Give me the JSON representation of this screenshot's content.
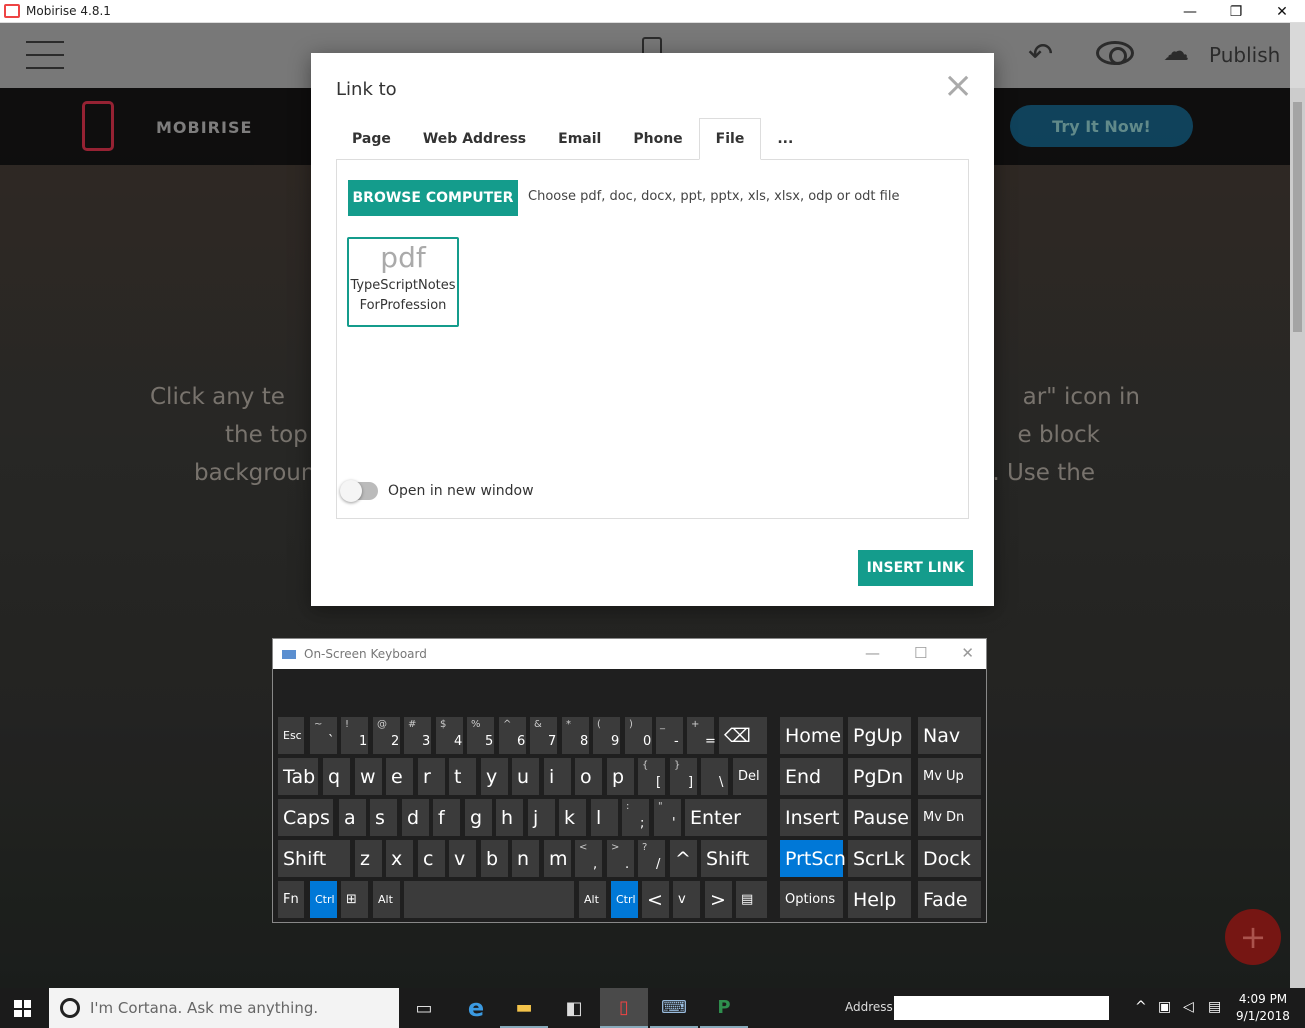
{
  "window": {
    "title": "Mobirise 4.8.1",
    "min": "—",
    "max": "❐",
    "close": "✕"
  },
  "toolbar": {
    "publish_label": "Publish"
  },
  "site": {
    "brand": "MOBIRISE",
    "cta": "Try It Now!",
    "hero_left": [
      "Click any te",
      "the top",
      "backgroun"
    ],
    "hero_right": [
      "ar\" icon in",
      "e block",
      ". Use the"
    ]
  },
  "modal": {
    "title": "Link to",
    "tabs": [
      "Page",
      "Web Address",
      "Email",
      "Phone",
      "File",
      "..."
    ],
    "active_tab": "File",
    "browse_label": "BROWSE COMPUTER",
    "hint": "Choose pdf, doc, docx, ppt, pptx, xls, xlsx, odp or odt file",
    "file": {
      "ext": "pdf",
      "name": "TypeScriptNotesForProfession"
    },
    "toggle_label": "Open in new window",
    "insert_label": "INSERT LINK"
  },
  "osk": {
    "title": "On-Screen Keyboard"
  },
  "taskbar": {
    "cortana": "I'm Cortana. Ask me anything.",
    "address_label": "Address",
    "time": "4:09 PM",
    "date": "9/1/2018"
  }
}
